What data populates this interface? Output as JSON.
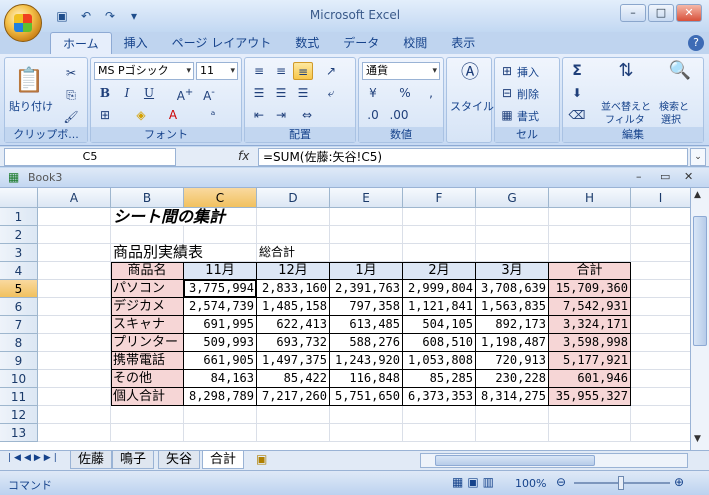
{
  "app": {
    "title": "Microsoft Excel",
    "workbook": "Book3"
  },
  "tabs": [
    "ホーム",
    "挿入",
    "ページ レイアウト",
    "数式",
    "データ",
    "校閲",
    "表示"
  ],
  "ribbon": {
    "clipboard": {
      "paste": "貼り付け",
      "label": "クリップボ..."
    },
    "font": {
      "name": "MS Pゴシック",
      "size": "11",
      "label": "フォント"
    },
    "alignment": {
      "label": "配置"
    },
    "number": {
      "format": "通貨",
      "label": "数値",
      "percent": "%",
      "comma": ","
    },
    "styles": {
      "label": "スタイル"
    },
    "cells": {
      "insert": "挿入",
      "delete": "削除",
      "format": "書式",
      "label": "セル"
    },
    "editing": {
      "sort": "並べ替えと",
      "filter": "フィルタ",
      "find": "検索と",
      "select": "選択",
      "label": "編集",
      "sigma": "Σ"
    }
  },
  "formula": {
    "namebox": "C5",
    "fx": "fx",
    "content": "=SUM(佐藤:矢谷!C5)"
  },
  "columns": [
    "A",
    "B",
    "C",
    "D",
    "E",
    "F",
    "G",
    "H",
    "I"
  ],
  "rows": [
    "1",
    "2",
    "3",
    "4",
    "5",
    "6",
    "7",
    "8",
    "9",
    "10",
    "11",
    "12",
    "13"
  ],
  "sheet": {
    "title": "シート間の集計",
    "subtitle": "商品別実績表",
    "subnote": "総合計",
    "headers": [
      "商品名",
      "11月",
      "12月",
      "1月",
      "2月",
      "3月",
      "合計"
    ],
    "body": [
      [
        "パソコン",
        "3,775,994",
        "2,833,160",
        "2,391,763",
        "2,999,804",
        "3,708,639",
        "15,709,360"
      ],
      [
        "デジカメ",
        "2,574,739",
        "1,485,158",
        "797,358",
        "1,121,841",
        "1,563,835",
        "7,542,931"
      ],
      [
        "スキャナ",
        "691,995",
        "622,413",
        "613,485",
        "504,105",
        "892,173",
        "3,324,171"
      ],
      [
        "プリンター",
        "509,993",
        "693,732",
        "588,276",
        "608,510",
        "1,198,487",
        "3,598,998"
      ],
      [
        "携帯電話",
        "661,905",
        "1,497,375",
        "1,243,920",
        "1,053,808",
        "720,913",
        "5,177,921"
      ],
      [
        "その他",
        "84,163",
        "85,422",
        "116,848",
        "85,285",
        "230,228",
        "601,946"
      ],
      [
        "個人合計",
        "8,298,789",
        "7,217,260",
        "5,751,650",
        "6,373,353",
        "8,314,275",
        "35,955,327"
      ]
    ]
  },
  "sheet_tabs": [
    "佐藤",
    "鳴子",
    "矢谷",
    "合計"
  ],
  "status": {
    "mode": "コマンド",
    "zoom": "100%"
  }
}
